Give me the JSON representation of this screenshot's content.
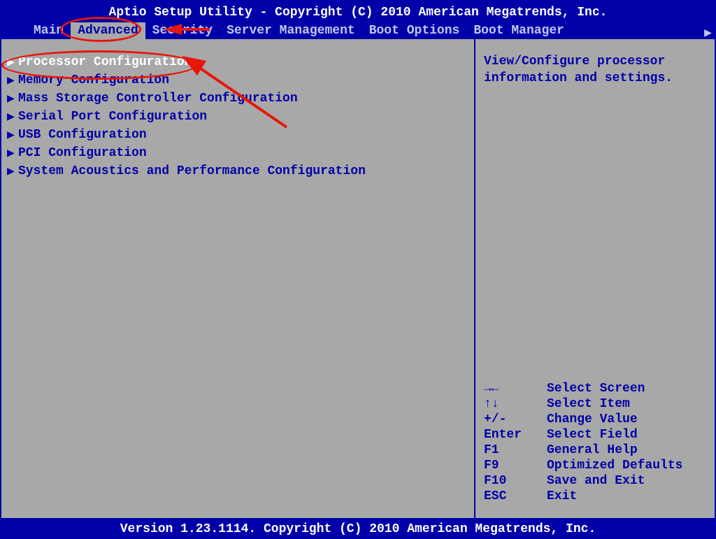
{
  "header": {
    "title": "Aptio Setup Utility - Copyright (C) 2010 American Megatrends, Inc.",
    "tabs": [
      {
        "label": "Main"
      },
      {
        "label": "Advanced"
      },
      {
        "label": "Security"
      },
      {
        "label": "Server Management"
      },
      {
        "label": "Boot Options"
      },
      {
        "label": "Boot Manager"
      }
    ],
    "selected_tab_index": 1
  },
  "menu": {
    "items": [
      {
        "label": "Processor Configuration"
      },
      {
        "label": "Memory Configuration"
      },
      {
        "label": "Mass Storage Controller Configuration"
      },
      {
        "label": "Serial Port Configuration"
      },
      {
        "label": "USB Configuration"
      },
      {
        "label": "PCI Configuration"
      },
      {
        "label": "System Acoustics and Performance Configuration"
      }
    ],
    "selected_index": 0
  },
  "help": {
    "text": "View/Configure processor information and settings."
  },
  "keys": [
    {
      "key": "→←",
      "desc": "Select Screen"
    },
    {
      "key": "↑↓",
      "desc": "Select Item"
    },
    {
      "key": "+/-",
      "desc": "Change Value"
    },
    {
      "key": "Enter",
      "desc": "Select Field"
    },
    {
      "key": "F1",
      "desc": "General Help"
    },
    {
      "key": "F9",
      "desc": "Optimized Defaults"
    },
    {
      "key": "F10",
      "desc": "Save and Exit"
    },
    {
      "key": "ESC",
      "desc": "Exit"
    }
  ],
  "footer": {
    "text": "Version 1.23.1114. Copyright (C) 2010 American Megatrends, Inc."
  }
}
